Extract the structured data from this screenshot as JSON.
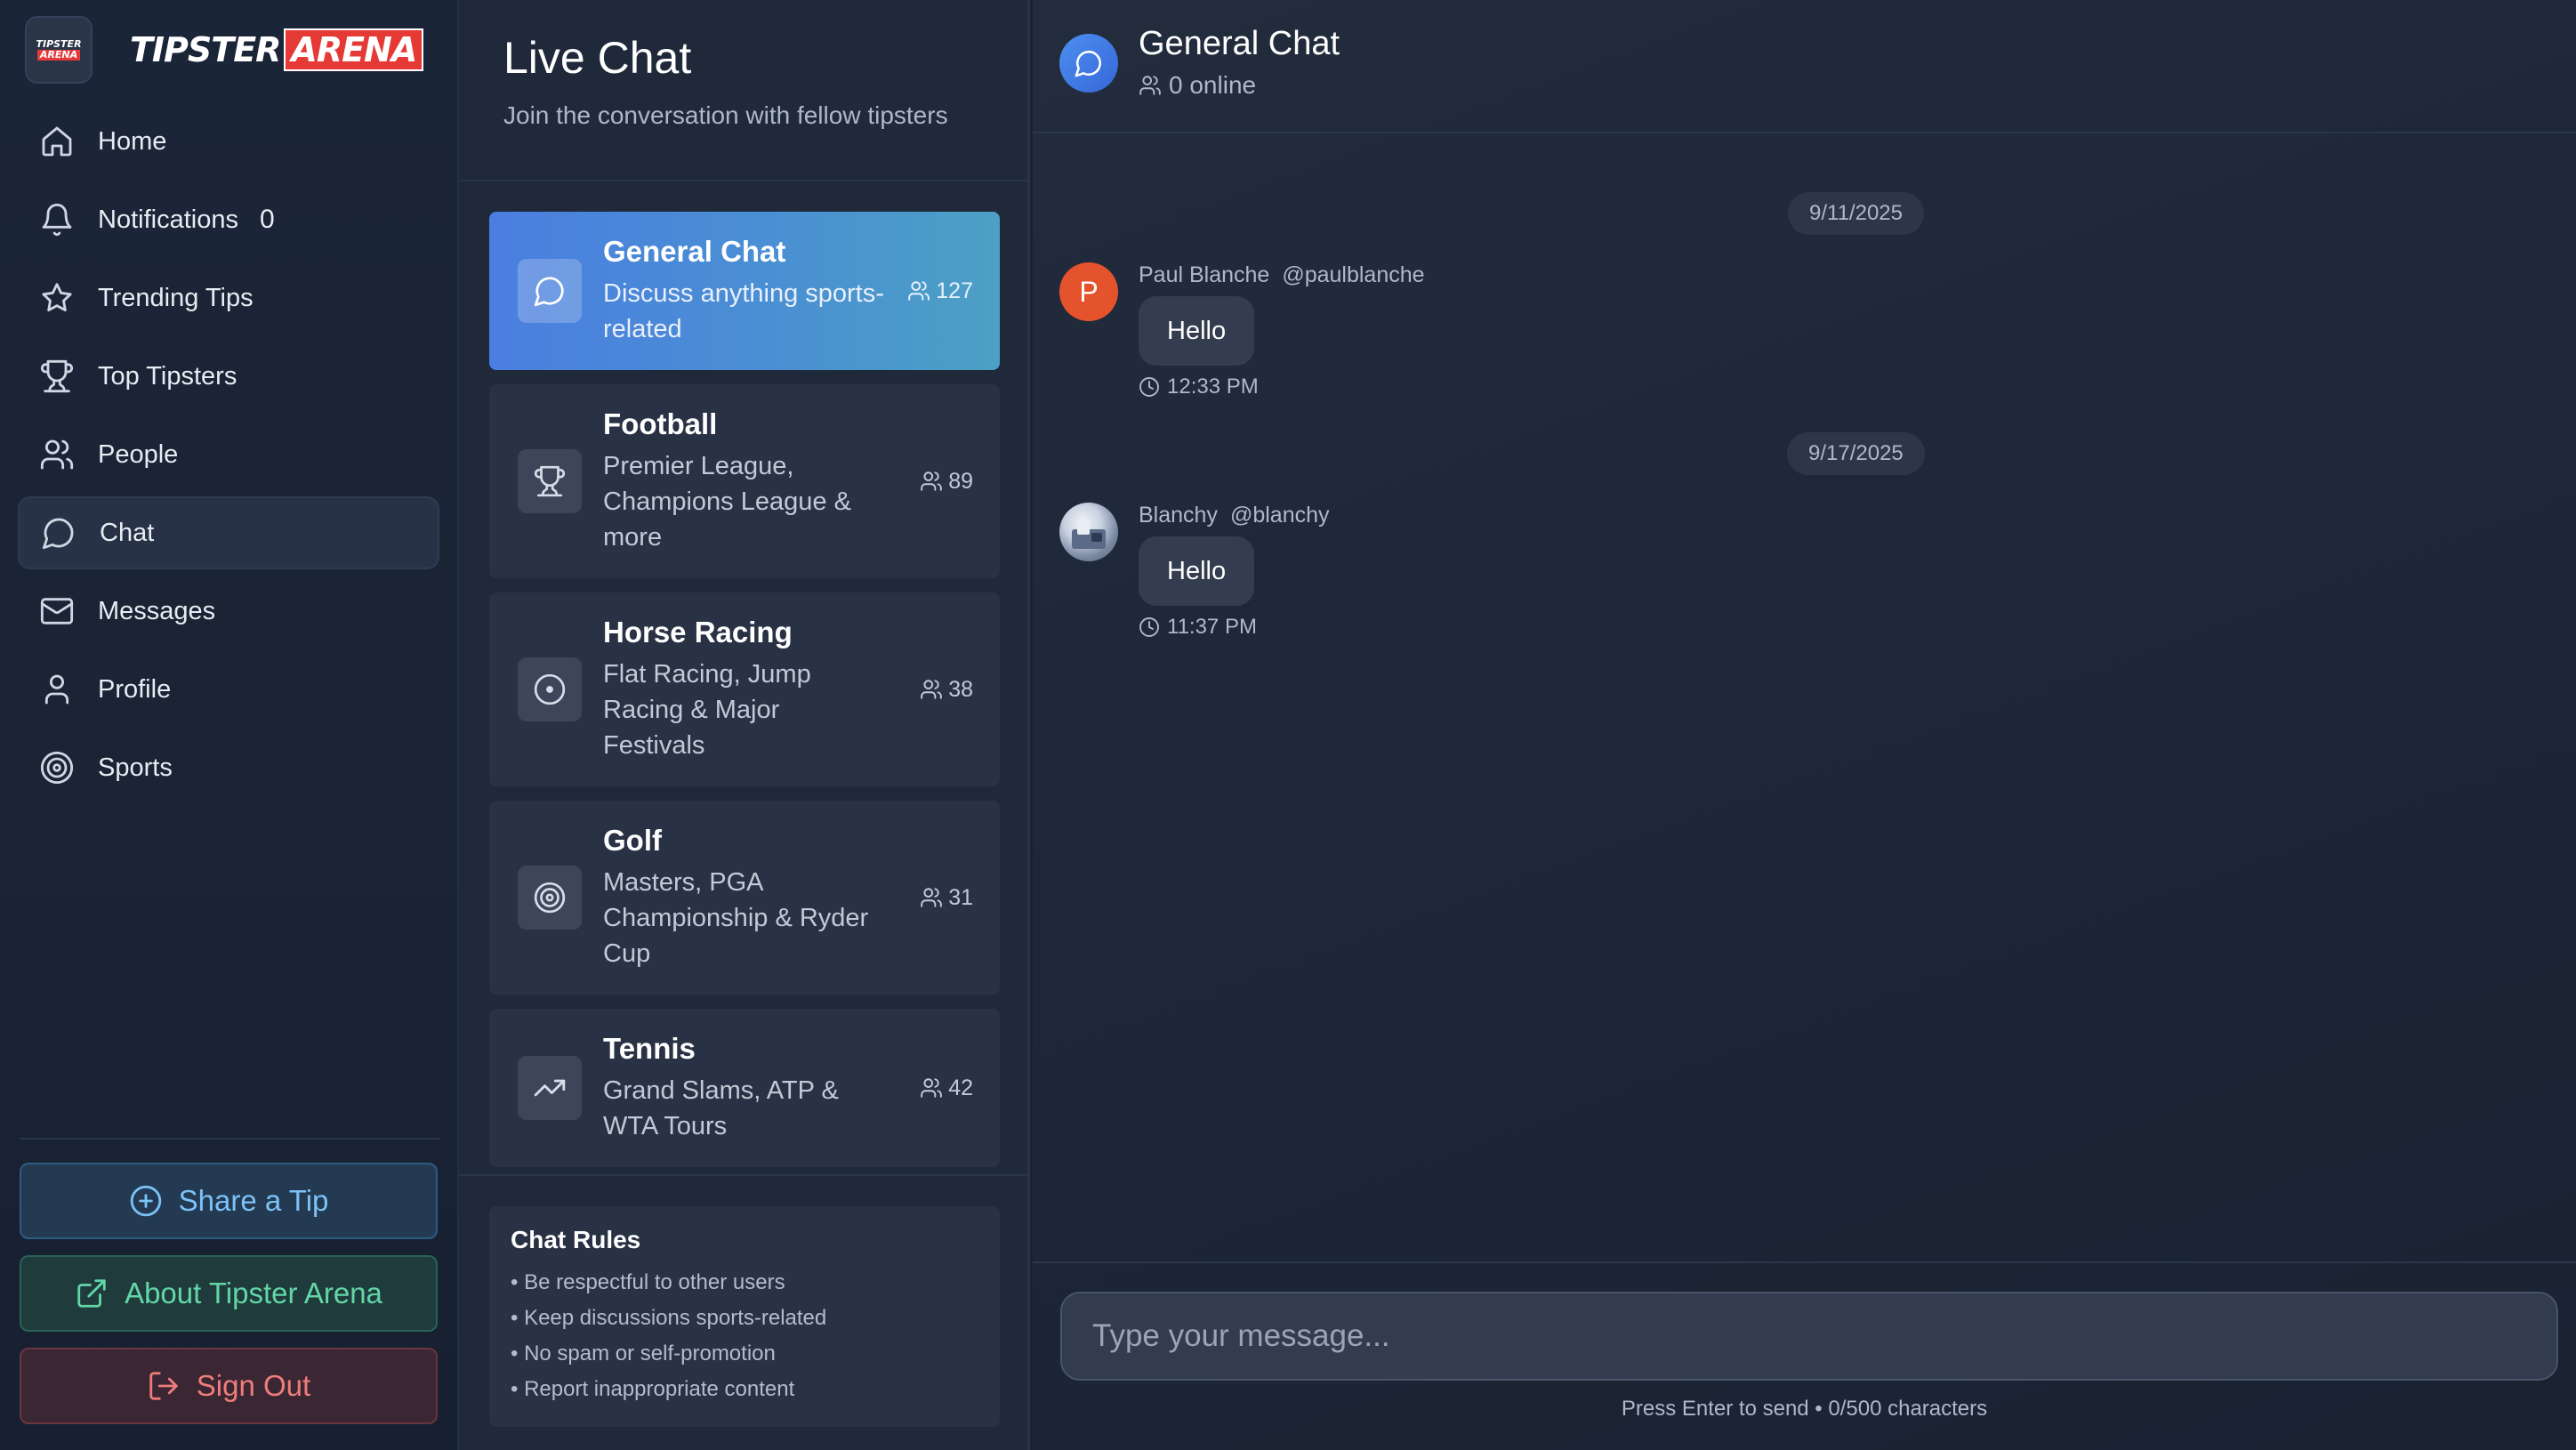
{
  "brand": {
    "name_part1": "TIPSTER",
    "name_part2": "ARENA",
    "logo_line1": "TIPSTER",
    "logo_line2": "ARENA"
  },
  "sidebar": {
    "items": [
      {
        "label": "Home",
        "icon": "home-icon"
      },
      {
        "label": "Notifications",
        "icon": "bell-icon",
        "badge": "0"
      },
      {
        "label": "Trending Tips",
        "icon": "star-icon"
      },
      {
        "label": "Top Tipsters",
        "icon": "trophy-icon"
      },
      {
        "label": "People",
        "icon": "users-icon"
      },
      {
        "label": "Chat",
        "icon": "chat-bubble-icon",
        "active": true
      },
      {
        "label": "Messages",
        "icon": "mail-icon"
      },
      {
        "label": "Profile",
        "icon": "user-icon"
      },
      {
        "label": "Sports",
        "icon": "target-icon"
      }
    ],
    "share_label": "Share a Tip",
    "about_label": "About Tipster Arena",
    "signout_label": "Sign Out"
  },
  "rooms_panel": {
    "title": "Live Chat",
    "subtitle": "Join the conversation with fellow tipsters",
    "rooms": [
      {
        "name": "General Chat",
        "description": "Discuss anything sports-related",
        "count": "127",
        "icon": "chat-bubble-icon",
        "active": true
      },
      {
        "name": "Football",
        "description": "Premier League, Champions League & more",
        "count": "89",
        "icon": "trophy-icon"
      },
      {
        "name": "Horse Racing",
        "description": "Flat Racing, Jump Racing & Major Festivals",
        "count": "38",
        "icon": "circle-dot-icon"
      },
      {
        "name": "Golf",
        "description": "Masters, PGA Championship & Ryder Cup",
        "count": "31",
        "icon": "target-icon"
      },
      {
        "name": "Tennis",
        "description": "Grand Slams, ATP & WTA Tours",
        "count": "42",
        "icon": "trending-up-icon"
      }
    ],
    "rules_title": "Chat Rules",
    "rules": [
      "Be respectful to other users",
      "Keep discussions sports-related",
      "No spam or self-promotion",
      "Report inappropriate content"
    ]
  },
  "chat": {
    "title": "General Chat",
    "online": "0 online",
    "messages": [
      {
        "date": "9/11/2025",
        "name": "Paul Blanche",
        "handle": "@paulblanche",
        "avatar_letter": "P",
        "text": "Hello",
        "time": "12:33 PM"
      },
      {
        "date": "9/17/2025",
        "name": "Blanchy",
        "handle": "@blanchy",
        "avatar_letter": "",
        "text": "Hello",
        "time": "11:37 PM"
      }
    ],
    "input_placeholder": "Type your message...",
    "hint": "Press Enter to send • 0/500 characters"
  },
  "colors": {
    "accent": "#4a7ee0",
    "share": "#7cc2f7",
    "about": "#63d6a6",
    "signout": "#f07c7c",
    "avatar_p": "#e5532d"
  }
}
